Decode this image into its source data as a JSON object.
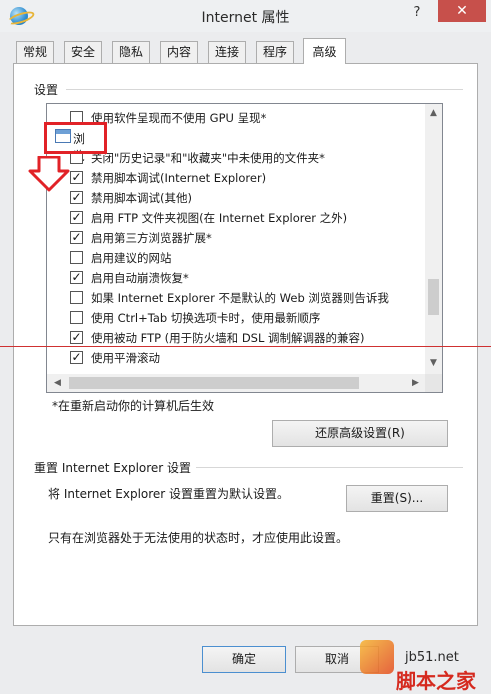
{
  "window": {
    "title": "Internet 属性",
    "help": "?",
    "close": "✕"
  },
  "tabs": [
    {
      "label": "常规"
    },
    {
      "label": "安全"
    },
    {
      "label": "隐私"
    },
    {
      "label": "内容"
    },
    {
      "label": "连接"
    },
    {
      "label": "程序"
    },
    {
      "label": "高级"
    }
  ],
  "settings": {
    "group_label": "设置",
    "category": "浏览",
    "items": [
      {
        "label": "使用软件呈现而不使用 GPU 呈现*",
        "mark": ""
      },
      {
        "label": "关闭\"历史记录\"和\"收藏夹\"中未使用的文件夹*",
        "mark": ""
      },
      {
        "label": "禁用脚本调试(Internet Explorer)",
        "mark": "✓"
      },
      {
        "label": "禁用脚本调试(其他)",
        "mark": "✓"
      },
      {
        "label": "启用 FTP 文件夹视图(在 Internet Explorer 之外)",
        "mark": "✓"
      },
      {
        "label": "启用第三方浏览器扩展*",
        "mark": "✓"
      },
      {
        "label": "启用建议的网站",
        "mark": ""
      },
      {
        "label": "启用自动崩溃恢复*",
        "mark": "✓"
      },
      {
        "label": "如果 Internet Explorer 不是默认的 Web 浏览器则告诉我",
        "mark": ""
      },
      {
        "label": "使用 Ctrl+Tab 切换选项卡时，使用最新顺序",
        "mark": ""
      },
      {
        "label": "使用被动 FTP (用于防火墙和 DSL 调制解调器的兼容)",
        "mark": "✓"
      },
      {
        "label": "使用平滑滚动",
        "mark": "✓"
      }
    ],
    "scroll_up": "▲",
    "scroll_down": "▼",
    "scroll_left": "◀",
    "scroll_right": "▶",
    "restart_note": "*在重新启动你的计算机后生效",
    "restore_button": "还原高级设置(R)"
  },
  "reset": {
    "group_label": "重置 Internet Explorer 设置",
    "description": "将 Internet Explorer 设置重置为默认设置。",
    "button": "重置(S)...",
    "note": "只有在浏览器处于无法使用的状态时，才应使用此设置。"
  },
  "footer": {
    "ok": "确定",
    "cancel": "取消"
  },
  "watermark": {
    "site": "jb51.net",
    "brand": "脚本之家"
  },
  "colors": {
    "annotation": "#e12227",
    "close_button": "#c7504b"
  }
}
